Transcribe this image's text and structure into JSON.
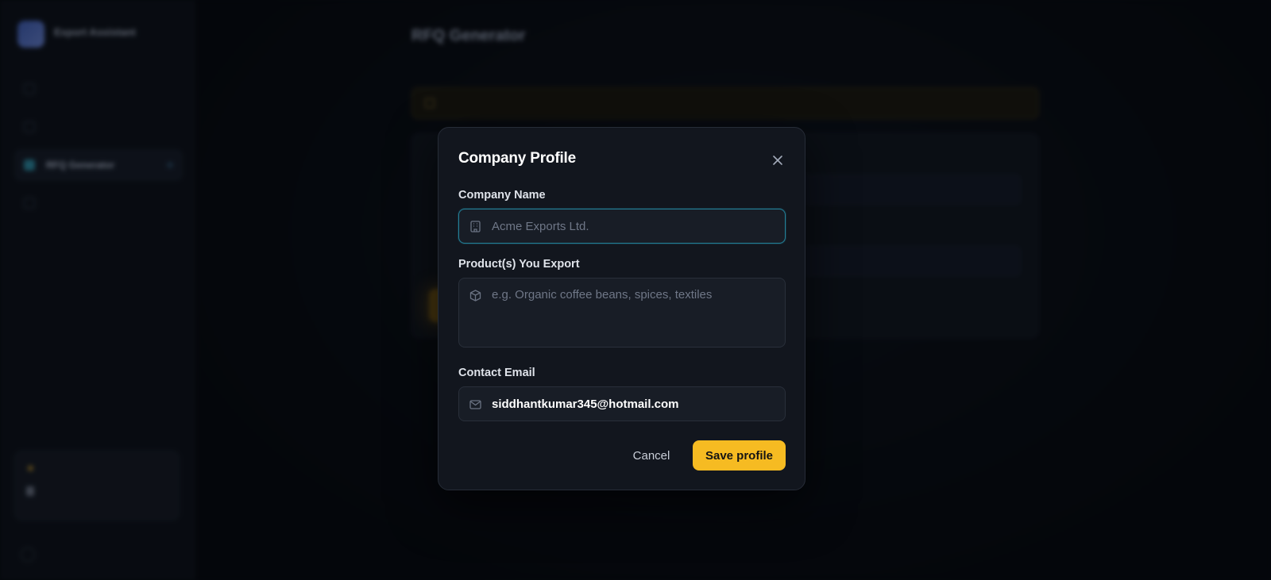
{
  "sidebar": {
    "brand_name": "Export Assistant",
    "brand_sub": "",
    "items": [
      {
        "label": ""
      },
      {
        "label": ""
      },
      {
        "label": "RFQ Generator"
      },
      {
        "label": ""
      }
    ],
    "usage_title": "",
    "usage_line": "",
    "account_name": ""
  },
  "page": {
    "title": "RFQ Generator",
    "subtitle": "",
    "notice": ""
  },
  "modal": {
    "title": "Company Profile",
    "company_name_label": "Company Name",
    "company_name_placeholder": "Acme Exports Ltd.",
    "company_name_value": "",
    "products_label": "Product(s) You Export",
    "products_placeholder": "e.g. Organic coffee beans, spices, textiles",
    "products_value": "",
    "email_label": "Contact Email",
    "email_value": "siddhantkumar345@hotmail.com",
    "cancel_label": "Cancel",
    "save_label": "Save profile"
  },
  "colors": {
    "accent": "#f6bb22",
    "focus_border": "#237f97",
    "modal_bg": "#12161e",
    "page_bg": "#07090e"
  },
  "icons": {
    "company_field": "building-icon",
    "products_field": "package-icon",
    "email_field": "mail-icon",
    "close": "close-icon"
  }
}
